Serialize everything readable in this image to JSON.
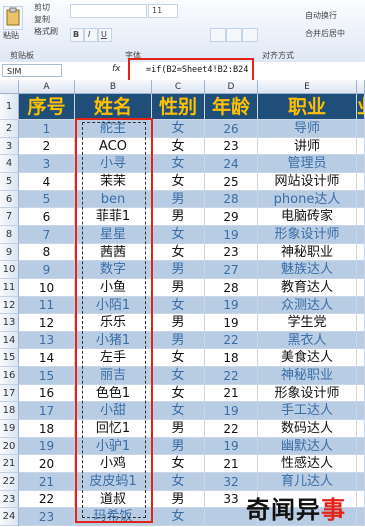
{
  "ribbon": {
    "clipboard": {
      "paste": "粘贴",
      "cut": "剪切",
      "copy": "复制",
      "format_painter": "格式刷",
      "group": "剪贴板"
    },
    "font": {
      "size": "11",
      "group": "字体"
    },
    "alignment": {
      "wrap": "自动换行",
      "merge": "合并后居中",
      "group": "对齐方式"
    }
  },
  "formula_bar": {
    "name_box": "SIM",
    "fx": "fx",
    "formula": "=if(B2=Sheet4!B2:B24"
  },
  "columns": [
    "A",
    "B",
    "C",
    "D",
    "E",
    ""
  ],
  "header_row": {
    "row_num": "1",
    "cells": [
      "序号",
      "姓名",
      "性别",
      "年龄",
      "职业",
      "业"
    ]
  },
  "rows": [
    {
      "n": "2",
      "no": "1",
      "name": "舵主",
      "sex": "女",
      "age": "26",
      "job": "导师",
      "zebra": true
    },
    {
      "n": "3",
      "no": "2",
      "name": "ACO",
      "sex": "女",
      "age": "23",
      "job": "讲师",
      "zebra": false
    },
    {
      "n": "4",
      "no": "3",
      "name": "小寻",
      "sex": "女",
      "age": "24",
      "job": "管理员",
      "zebra": true
    },
    {
      "n": "5",
      "no": "4",
      "name": "茉茉",
      "sex": "女",
      "age": "25",
      "job": "网站设计师",
      "zebra": false
    },
    {
      "n": "6",
      "no": "5",
      "name": "ben",
      "sex": "男",
      "age": "28",
      "job": "phone达人",
      "zebra": true
    },
    {
      "n": "7",
      "no": "6",
      "name": "菲菲1",
      "sex": "男",
      "age": "29",
      "job": "电脑砖家",
      "zebra": false
    },
    {
      "n": "8",
      "no": "7",
      "name": "星星",
      "sex": "女",
      "age": "19",
      "job": "形象设计师",
      "zebra": true
    },
    {
      "n": "9",
      "no": "8",
      "name": "茜茜",
      "sex": "女",
      "age": "23",
      "job": "神秘职业",
      "zebra": false
    },
    {
      "n": "10",
      "no": "9",
      "name": "数字",
      "sex": "男",
      "age": "27",
      "job": "魅族达人",
      "zebra": true
    },
    {
      "n": "11",
      "no": "10",
      "name": "小鱼",
      "sex": "男",
      "age": "28",
      "job": "教育达人",
      "zebra": false
    },
    {
      "n": "12",
      "no": "11",
      "name": "小陌1",
      "sex": "女",
      "age": "19",
      "job": "众测达人",
      "zebra": true
    },
    {
      "n": "13",
      "no": "12",
      "name": "乐乐",
      "sex": "男",
      "age": "19",
      "job": "学生党",
      "zebra": false
    },
    {
      "n": "14",
      "no": "13",
      "name": "小猪1",
      "sex": "男",
      "age": "22",
      "job": "黑衣人",
      "zebra": true
    },
    {
      "n": "15",
      "no": "14",
      "name": "左手",
      "sex": "女",
      "age": "18",
      "job": "美食达人",
      "zebra": false
    },
    {
      "n": "16",
      "no": "15",
      "name": "丽吉",
      "sex": "女",
      "age": "22",
      "job": "神秘职业",
      "zebra": true
    },
    {
      "n": "17",
      "no": "16",
      "name": "色色1",
      "sex": "女",
      "age": "21",
      "job": "形象设计师",
      "zebra": false
    },
    {
      "n": "18",
      "no": "17",
      "name": "小甜",
      "sex": "女",
      "age": "19",
      "job": "手工达人",
      "zebra": true
    },
    {
      "n": "19",
      "no": "18",
      "name": "回忆1",
      "sex": "男",
      "age": "22",
      "job": "数码达人",
      "zebra": false
    },
    {
      "n": "20",
      "no": "19",
      "name": "小驴1",
      "sex": "男",
      "age": "19",
      "job": "幽默达人",
      "zebra": true
    },
    {
      "n": "21",
      "no": "20",
      "name": "小鸡",
      "sex": "女",
      "age": "21",
      "job": "性感达人",
      "zebra": false
    },
    {
      "n": "22",
      "no": "21",
      "name": "皮皮蚂1",
      "sex": "女",
      "age": "32",
      "job": "育儿达人",
      "zebra": true
    },
    {
      "n": "23",
      "no": "22",
      "name": "道叔",
      "sex": "男",
      "age": "33",
      "job": "",
      "zebra": false
    },
    {
      "n": "24",
      "no": "23",
      "name": "玛希饭",
      "sex": "女",
      "age": "",
      "job": "",
      "zebra": true
    }
  ],
  "watermark": {
    "a": "奇闻异",
    "b": "事"
  },
  "colors": {
    "header_bg": "#1f4e79",
    "header_fg": "#ffc000",
    "zebra_bg": "#b8cce4",
    "plain_bg": "#ffffff",
    "highlight": "#e2231a"
  }
}
